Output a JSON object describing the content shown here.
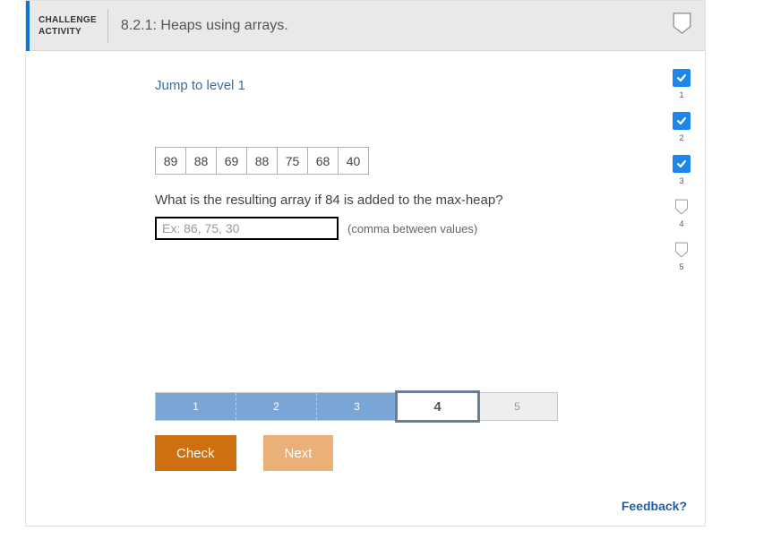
{
  "header": {
    "challenge_line1": "CHALLENGE",
    "challenge_line2": "ACTIVITY",
    "title": "8.2.1: Heaps using arrays."
  },
  "jump_link": "Jump to level 1",
  "array": [
    "89",
    "88",
    "69",
    "88",
    "75",
    "68",
    "40"
  ],
  "question": "What is the resulting array if 84 is added to the max-heap?",
  "input_placeholder": "Ex: 86, 75, 30",
  "hint": "(comma between values)",
  "progress": [
    {
      "num": "1",
      "done": true
    },
    {
      "num": "2",
      "done": true
    },
    {
      "num": "3",
      "done": true
    },
    {
      "num": "4",
      "done": false
    },
    {
      "num": "5",
      "done": false
    }
  ],
  "steps": [
    {
      "label": "1",
      "state": "done"
    },
    {
      "label": "2",
      "state": "done"
    },
    {
      "label": "3",
      "state": "done"
    },
    {
      "label": "4",
      "state": "current"
    },
    {
      "label": "5",
      "state": "future"
    }
  ],
  "buttons": {
    "check": "Check",
    "next": "Next"
  },
  "feedback": "Feedback?"
}
